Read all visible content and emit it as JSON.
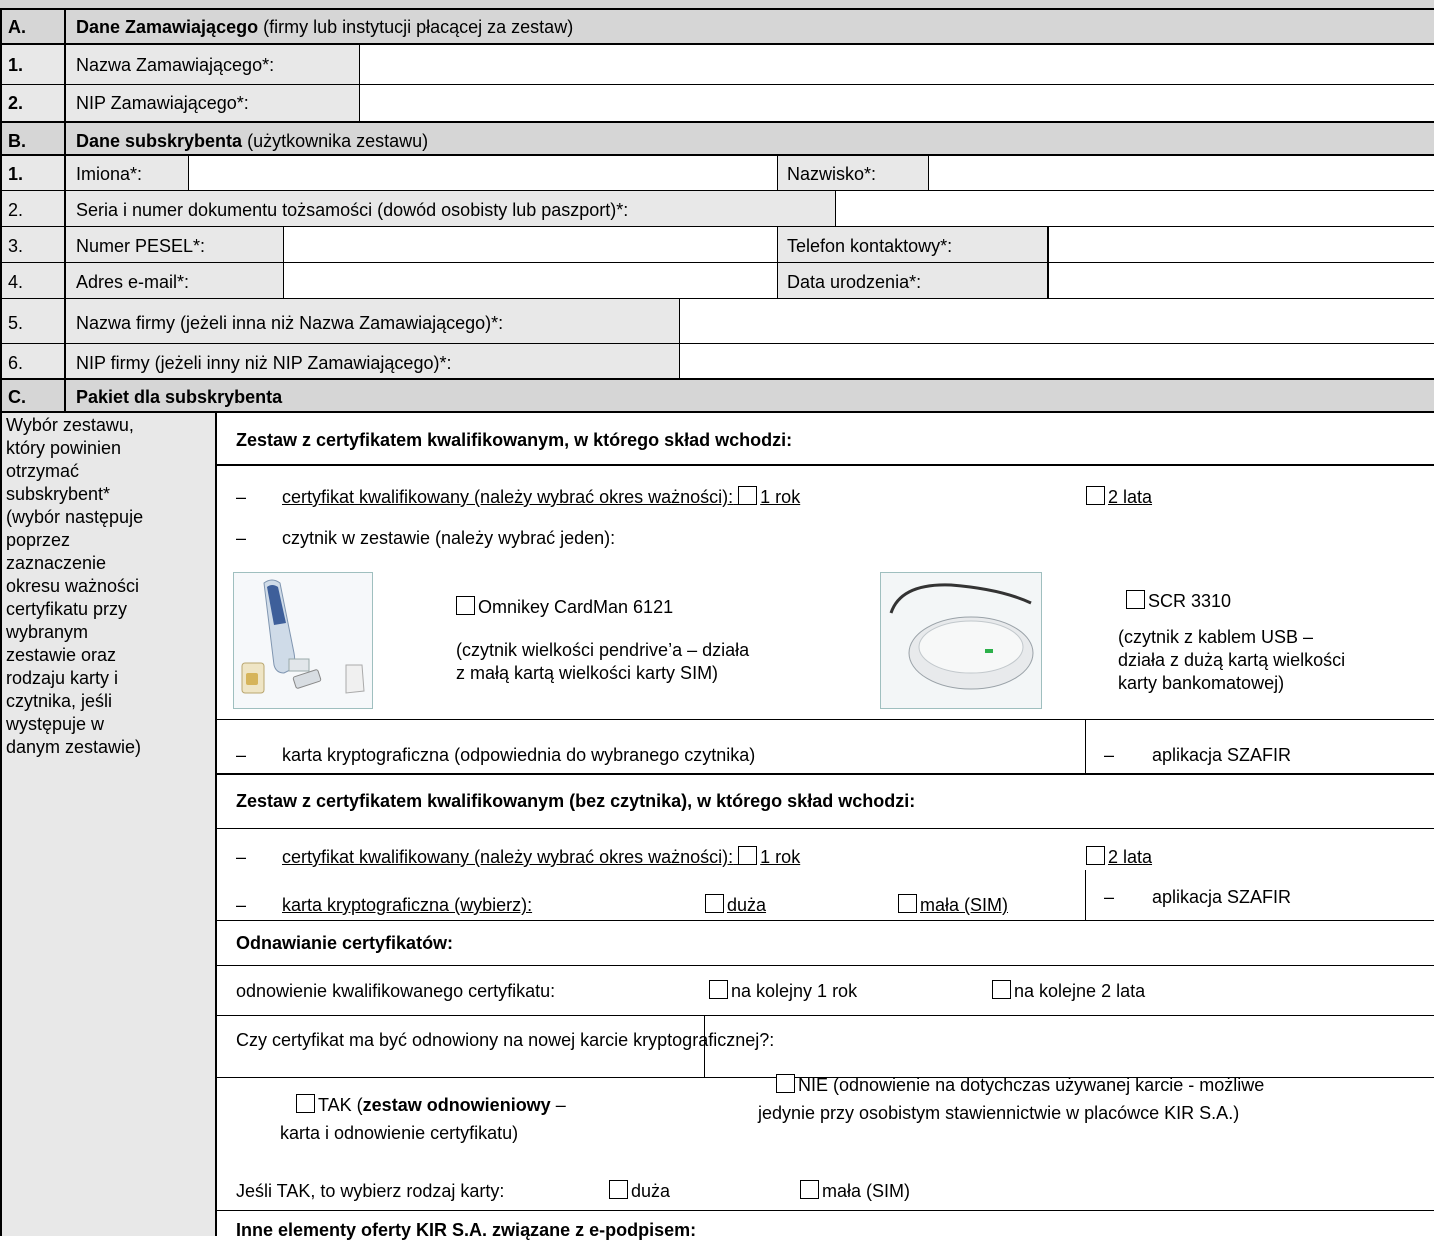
{
  "sectionA": {
    "letter": "A.",
    "title_bold": "Dane Zamawiającego",
    "title_rest": "(firmy lub instytucji płacącej za zestaw)",
    "rows": [
      {
        "num": "1.",
        "label": "Nazwa Zamawiającego*:",
        "value": ""
      },
      {
        "num": "2.",
        "label": "NIP Zamawiającego*:",
        "value": ""
      }
    ]
  },
  "sectionB": {
    "letter": "B.",
    "title_bold": "Dane subskrybenta",
    "title_rest": "(użytkownika zestawu)",
    "r1": {
      "num": "1.",
      "label_left": "Imiona*:",
      "label_right": "Nazwisko*:"
    },
    "r2": {
      "num": "2.",
      "label": "Seria i numer dokumentu tożsamości (dowód osobisty lub paszport)*:"
    },
    "r3": {
      "num": "3.",
      "label_left": "Numer PESEL*:",
      "label_right": "Telefon kontaktowy*:"
    },
    "r4": {
      "num": "4.",
      "label_left": "Adres e-mail*:",
      "label_right": "Data urodzenia*:"
    },
    "r5": {
      "num": "5.",
      "label": "Nazwa firmy (jeżeli inna niż Nazwa Zamawiającego)*:"
    },
    "r6": {
      "num": "6.",
      "label": "NIP firmy (jeżeli inny niż NIP Zamawiającego)*:"
    }
  },
  "sectionC": {
    "letter": "C.",
    "title": "Pakiet dla subskrybenta",
    "side_text": [
      "Wybór zestawu,",
      "który powinien",
      "otrzymać",
      "subskrybent*",
      "(wybór następuje",
      "poprzez",
      "zaznaczenie",
      "okresu ważności",
      "certyfikatu przy",
      "wybranym",
      "zestawie oraz",
      "rodzaju karty i",
      "czytnika, jeśli",
      "występuje w",
      "danym zestawie)"
    ],
    "kit1": {
      "title": "Zestaw z certyfikatem kwalifikowanym, w którego skład wchodzi:",
      "dash": "–",
      "cert_label": "certyfikat kwalifikowany (należy wybrać okres ważności):",
      "opt_1y": "1 rok",
      "opt_2y": "2 lata",
      "reader_label": "czytnik w zestawie (należy wybrać jeden):",
      "reader1_name": "Omnikey CardMan 6121",
      "reader1_desc": [
        "(czytnik wielkości pendrive’a – działa",
        "z małą kartą wielkości karty SIM)"
      ],
      "reader2_name": "SCR 3310",
      "reader2_desc": [
        "(czytnik z kablem USB –",
        "działa z dużą kartą wielkości",
        "karty bankomatowej)"
      ],
      "card_label": "karta kryptograficzna (odpowiednia do wybranego czytnika)",
      "app_label": "aplikacja SZAFIR"
    },
    "kit2": {
      "title": "Zestaw z certyfikatem kwalifikowanym (bez czytnika), w którego skład wchodzi:",
      "cert_label": "certyfikat kwalifikowany (należy wybrać okres ważności):",
      "opt_1y": "1 rok",
      "opt_2y": "2 lata",
      "card_label": "karta kryptograficzna (wybierz):",
      "opt_big": "duża",
      "opt_small": "mała (SIM)",
      "app_label": "aplikacja SZAFIR"
    },
    "renew": {
      "title": "Odnawianie certyfikatów:",
      "label": "odnowienie kwalifikowanego certyfikatu:",
      "opt_1y": "na kolejny 1 rok",
      "opt_2y": "na kolejne 2 lata",
      "question": "Czy certyfikat ma być odnowiony na nowej karcie kryptograficznej?:",
      "yes_check": "TAK (",
      "yes_bold": "zestaw odnowieniowy",
      "yes_rest": " –",
      "yes_line2": "karta i odnowienie certyfikatu)",
      "no_line1": "NIE (odnowienie na dotychczas używanej karcie - możliwe",
      "no_line2": "jedynie przy osobistym stawiennictwie w placówce KIR S.A.)",
      "if_yes": "Jeśli TAK, to wybierz rodzaj karty:",
      "opt_big": "duża",
      "opt_small": "mała (SIM)"
    },
    "other_title": "Inne elementy oferty KIR S.A. związane z e-podpisem:"
  }
}
